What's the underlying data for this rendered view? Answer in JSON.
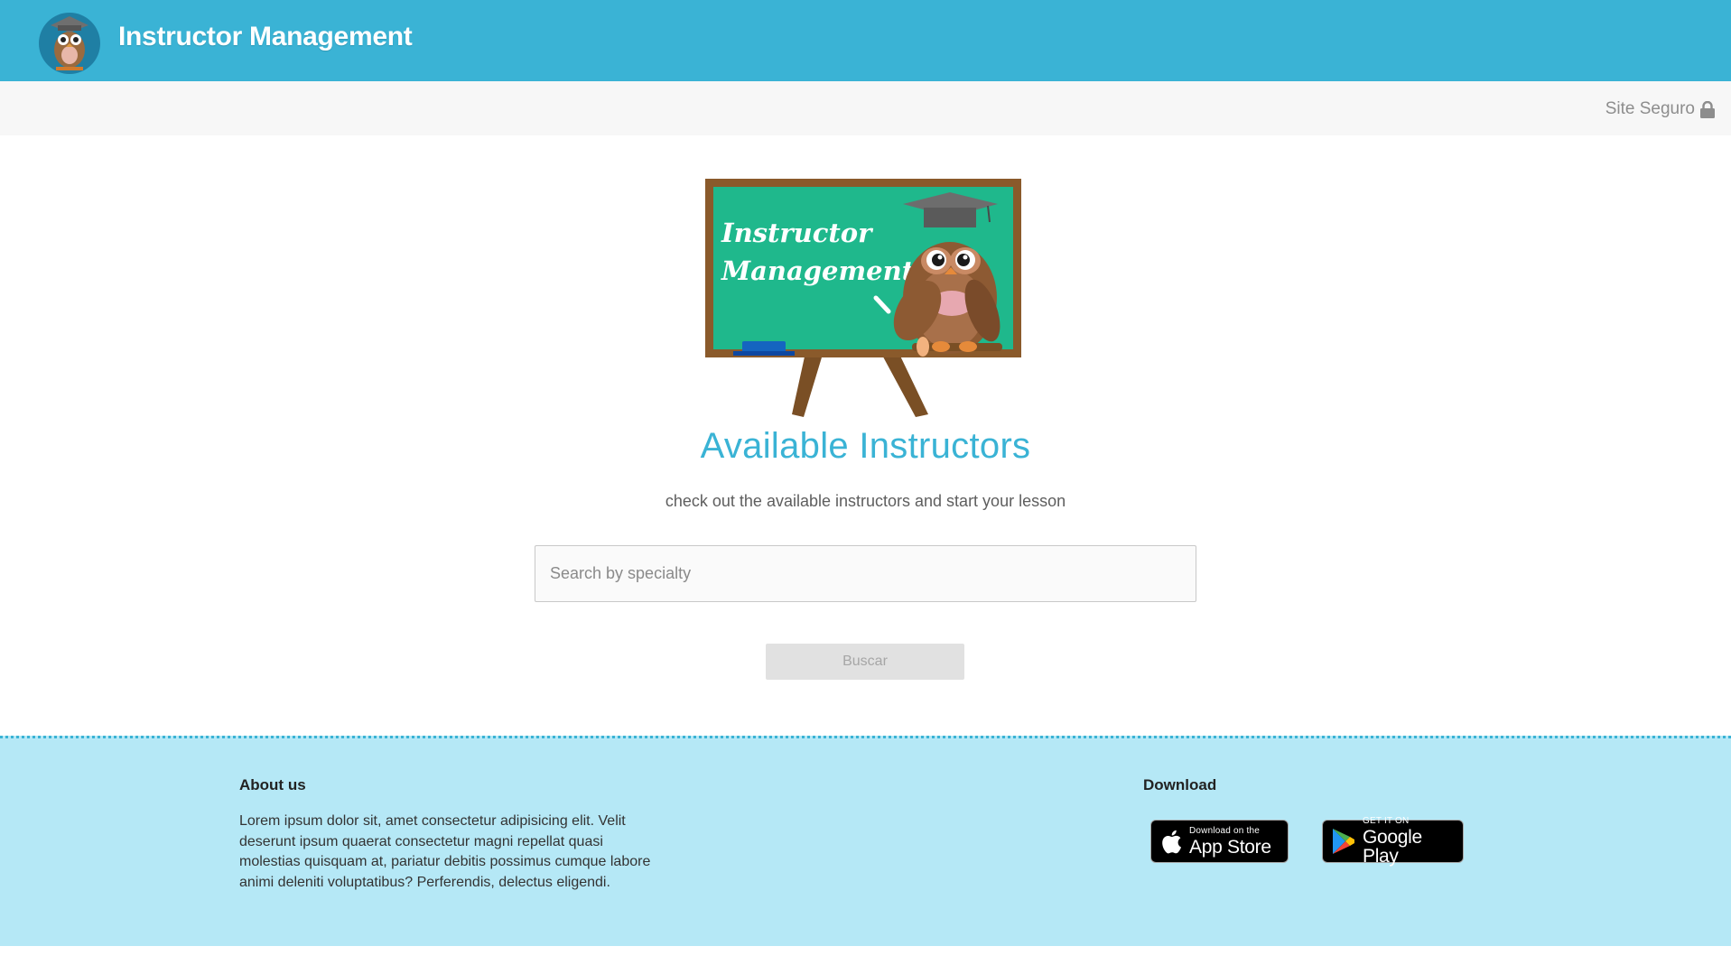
{
  "header": {
    "title": "Instructor Management",
    "secure_label": "Site Seguro"
  },
  "hero": {
    "board_text_line1": "Instructor",
    "board_text_line2": "Management",
    "heading": "Available Instructors",
    "subheading": "check out the available instructors and start your lesson"
  },
  "search": {
    "placeholder": "Search by specialty",
    "value": "",
    "button_label": "Buscar"
  },
  "footer": {
    "about_title": "About us",
    "about_text": "Lorem ipsum dolor sit, amet consectetur adipisicing elit. Velit deserunt ipsum quaerat consectetur magni repellat quasi molestias quisquam at, pariatur debitis possimus cumque labore animi deleniti voluptatibus? Perferendis, delectus eligendi.",
    "download_title": "Download",
    "app_store": {
      "small": "Download on the",
      "big": "App Store"
    },
    "google_play": {
      "small": "GET IT ON",
      "big": "Google Play"
    }
  },
  "colors": {
    "brand": "#3ab3d5",
    "footer_bg": "#b5e8f6",
    "board_green": "#1fb88c",
    "board_frame": "#8a5a2b"
  },
  "icons": [
    "owl-logo-icon",
    "lock-icon",
    "apple-icon",
    "google-play-icon"
  ]
}
